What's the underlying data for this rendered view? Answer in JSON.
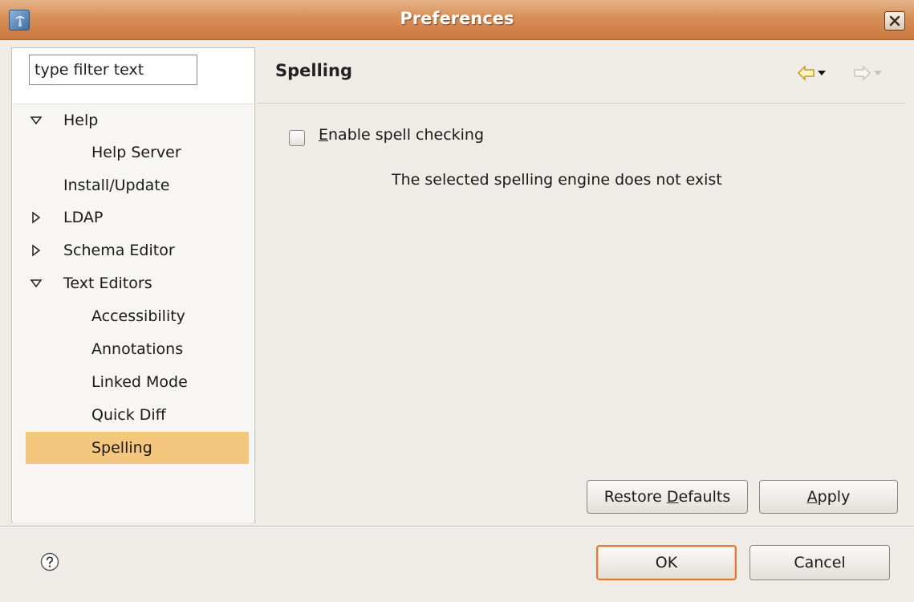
{
  "window": {
    "title": "Preferences",
    "accent": "#d9925a"
  },
  "filter": {
    "value": "type filter text"
  },
  "tree": {
    "items": [
      {
        "label": "Help",
        "toggle": "expanded",
        "indent": 0
      },
      {
        "label": "Help Server",
        "toggle": "none",
        "indent": 1
      },
      {
        "label": "Install/Update",
        "toggle": "none",
        "indent": 0
      },
      {
        "label": "LDAP",
        "toggle": "collapsed",
        "indent": 0
      },
      {
        "label": "Schema Editor",
        "toggle": "collapsed",
        "indent": 0
      },
      {
        "label": "Text Editors",
        "toggle": "expanded",
        "indent": 0
      },
      {
        "label": "Accessibility",
        "toggle": "none",
        "indent": 1
      },
      {
        "label": "Annotations",
        "toggle": "none",
        "indent": 1
      },
      {
        "label": "Linked Mode",
        "toggle": "none",
        "indent": 1
      },
      {
        "label": "Quick Diff",
        "toggle": "none",
        "indent": 1
      },
      {
        "label": "Spelling",
        "toggle": "none",
        "indent": 1,
        "selected": true
      }
    ],
    "selection_color": "#f5c77e"
  },
  "page": {
    "title": "Spelling",
    "back_icon": "back-arrow-icon",
    "forward_icon": "forward-arrow-icon"
  },
  "spelling": {
    "checkbox_label_mnemonic": "E",
    "checkbox_label_rest": "nable spell checking",
    "checked": false,
    "message": "The selected spelling engine does not exist"
  },
  "buttons": {
    "restore_pre": "Restore ",
    "restore_mnemonic": "D",
    "restore_post": "efaults",
    "apply_mnemonic": "A",
    "apply_rest": "pply",
    "ok": "OK",
    "cancel": "Cancel"
  },
  "icons": {
    "help": "help-icon",
    "close": "close-icon"
  }
}
